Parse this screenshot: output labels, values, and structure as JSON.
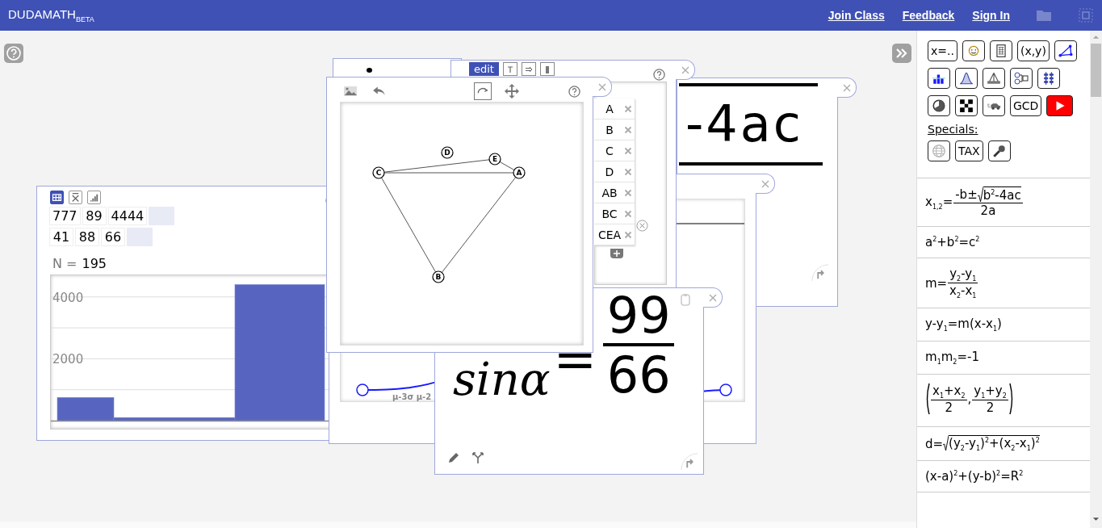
{
  "header": {
    "brand": "DUDAMATH",
    "badge": "BETA",
    "links": [
      "Join Class",
      "Feedback",
      "Sign In"
    ]
  },
  "windows": [
    {
      "kind": "stats",
      "tabs": [
        {
          "selected": true
        },
        {
          "selected": false
        },
        {
          "selected": false
        }
      ],
      "rows": [
        [
          "777",
          "89",
          "4444"
        ],
        [
          "41",
          "88",
          "66"
        ]
      ],
      "n_label": "N =",
      "n_value": "195",
      "chart_data": {
        "type": "bar",
        "values": [
          750,
          100,
          4400
        ],
        "ylim": [
          0,
          4700
        ],
        "yticks": [
          2000,
          4000
        ]
      }
    },
    {
      "kind": "blank"
    },
    {
      "kind": "expression",
      "text": "-4ac"
    },
    {
      "kind": "normal",
      "axis_labels": "μ-3σ μ-2"
    },
    {
      "kind": "list",
      "tabs": [
        {
          "label": "edit",
          "selected": true
        },
        {
          "selected": false
        },
        {
          "selected": false
        },
        {
          "selected": false
        }
      ],
      "items": [
        "A",
        "B",
        "C",
        "D",
        "AB",
        "BC",
        "CEA"
      ]
    },
    {
      "kind": "equation",
      "lhs": "sinα",
      "sign": "=",
      "num": "99",
      "den": "66"
    },
    {
      "kind": "graph",
      "tools": [
        {
          "selected": false
        },
        {
          "selected": false
        },
        {
          "selected": true
        },
        {
          "selected": false
        }
      ],
      "nodes": [
        "A",
        "B",
        "C",
        "D",
        "E"
      ]
    }
  ],
  "sidebar": {
    "tools": [
      [
        {
          "kind": "text",
          "label": "x=.."
        },
        {
          "kind": "icon"
        },
        {
          "kind": "icon"
        },
        {
          "kind": "text",
          "label": "(x,y)"
        },
        {
          "kind": "icon"
        }
      ],
      [
        {
          "kind": "icon"
        },
        {
          "kind": "icon"
        },
        {
          "kind": "icon"
        },
        {
          "kind": "icon"
        },
        {
          "kind": "icon"
        }
      ],
      [
        {
          "kind": "icon"
        },
        {
          "kind": "icon"
        },
        {
          "kind": "icon"
        },
        {
          "kind": "text",
          "label": "GCD"
        },
        {
          "kind": "icon"
        }
      ]
    ],
    "specials_label": "Specials:",
    "specials": [
      {
        "kind": "icon"
      },
      {
        "kind": "text",
        "label": "TAX"
      },
      {
        "kind": "icon"
      }
    ],
    "formulas": [
      {
        "segs": [
          {
            "t": "x$_{1,2}$="
          },
          {
            "frac": [
              [
                {
                  "t": "-b±"
                },
                {
                  "sqrt": [
                    {
                      "t": "b$^{2}$-4ac"
                    }
                  ]
                }
              ],
              [
                {
                  "t": "2a"
                }
              ]
            ]
          }
        ]
      },
      {
        "segs": [
          {
            "t": "a$^{2}$+b$^{2}$=c$^{2}$"
          }
        ]
      },
      {
        "segs": [
          {
            "t": "m="
          },
          {
            "frac": [
              [
                {
                  "t": "y$_{2}$-y$_{1}$"
                }
              ],
              [
                {
                  "t": "x$_{2}$-x$_{1}$"
                }
              ]
            ]
          }
        ]
      },
      {
        "segs": [
          {
            "t": "y-y$_{1}$=m(x-x$_{1}$)"
          }
        ]
      },
      {
        "segs": [
          {
            "t": "m$_{1}$m$_{2}$=-1"
          }
        ]
      },
      {
        "segs": [
          {
            "paren": [
              {
                "frac": [
                  [
                    {
                      "t": "x$_{1}$+x$_{2}$"
                    }
                  ],
                  [
                    {
                      "t": "2"
                    }
                  ]
                ]
              },
              {
                "t": ","
              },
              {
                "frac": [
                  [
                    {
                      "t": "y$_{1}$+y$_{2}$"
                    }
                  ],
                  [
                    {
                      "t": "2"
                    }
                  ]
                ]
              }
            ]
          }
        ]
      },
      {
        "segs": [
          {
            "t": "d="
          },
          {
            "sqrt": [
              {
                "t": "(y$_{2}$-y$_{1}$)$^{2}$+(x$_{2}$-x$_{1}$)$^{2}$"
              }
            ]
          }
        ]
      },
      {
        "segs": [
          {
            "t": "(x-a)$^{2}$+(y-b)$^{2}$=R$^{2}$"
          }
        ]
      }
    ]
  }
}
